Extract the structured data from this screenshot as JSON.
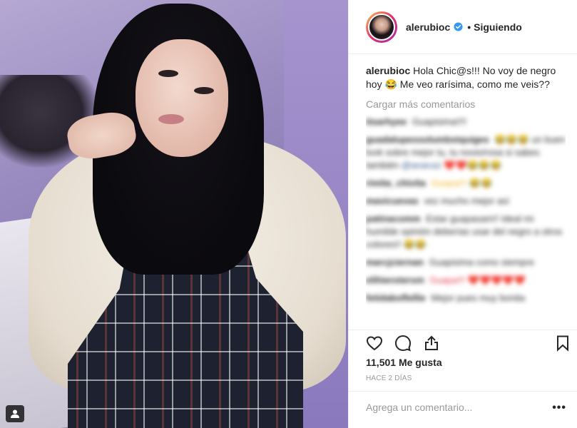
{
  "post": {
    "username": "alerubioc",
    "separator": "•",
    "follow_label": "Siguiendo",
    "caption_user": "alerubioc",
    "caption_text": "Hola Chic@s!!! No voy de negro hoy 😂 Me veo rarísima, como me veis??",
    "load_more_label": "Cargar más comentarios",
    "likes_label": "11,501 Me gusta",
    "time_label": "HACE 2 DÍAS",
    "comment_placeholder": "Agrega un comentario...",
    "more_label": "•••"
  },
  "blurred_comments": [
    {
      "user": "itsarhyee",
      "text": "Guapisima!!!!"
    },
    {
      "user": "guadalupeosolumbstquiges",
      "text": "😂😂😂 un buen look sobre mejor tu, tu novio/rosa si sabes también",
      "mention": "@anaruiz",
      "tail": "❤️❤️😂😂😂"
    },
    {
      "user": "rimita_chivita",
      "text": "Guapa!!! 😂😂"
    },
    {
      "user": "mavicuevas",
      "text": "vez mucho mejor así"
    },
    {
      "user": "patinacomm",
      "text": "Estar guapasam!! Ideal mi humilde opinión deberías usar del negro a otros colores!! 😂😂"
    },
    {
      "user": "marcjciernan",
      "text": "Guapisima como siempre"
    },
    {
      "user": "elihierotersm",
      "text": "Guapa!!! ❤️❤️❤️❤️❤️"
    },
    {
      "user": "fetidaboflellie",
      "text": "Mejor pues muy bonita"
    }
  ],
  "icons": {
    "like": "heart-outline-icon",
    "comment": "speech-bubble-icon",
    "share": "share-upload-icon",
    "save": "bookmark-icon",
    "user_tag": "person-tag-icon",
    "verified": "verified-badge-icon"
  },
  "colors": {
    "verified": "#3897f0",
    "muted": "#999999",
    "text": "#262626",
    "divider": "#efefef"
  }
}
